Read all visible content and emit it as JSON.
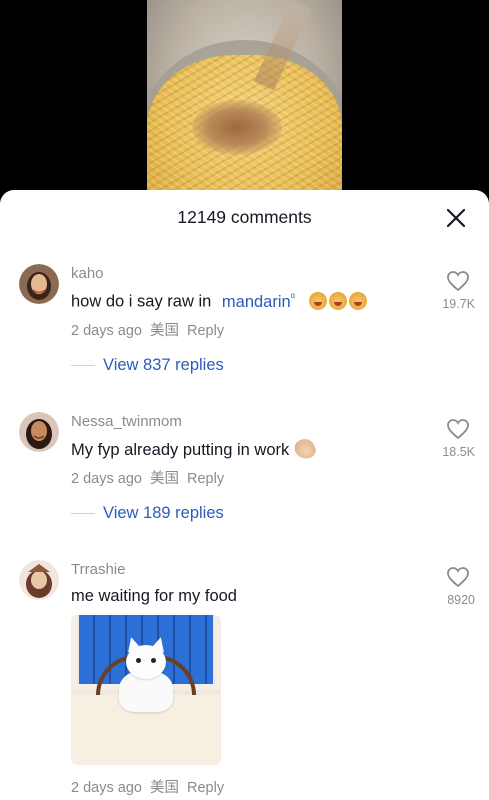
{
  "header": {
    "comment_count": "12149 comments",
    "close_icon": "close-icon"
  },
  "comments": [
    {
      "username": "kaho",
      "text": "how do i say raw in ",
      "link_text": "mandarin",
      "link_suffix": "ᵅ",
      "date": "2 days ago",
      "location": "美国",
      "reply_label": "Reply",
      "likes": "19.7K",
      "view_replies": "View 837 replies",
      "emojis": [
        "emoji-face",
        "emoji-face",
        "emoji-face"
      ]
    },
    {
      "username": "Nessa_twinmom",
      "text": "My fyp already putting in work",
      "date": "2 days ago",
      "location": "美国",
      "reply_label": "Reply",
      "likes": "18.5K",
      "view_replies": "View 189 replies",
      "emojis": [
        "pinching-hand"
      ]
    },
    {
      "username": "Trrashie",
      "text": "me waiting for my food",
      "date": "2 days ago",
      "location": "美国",
      "reply_label": "Reply",
      "likes": "8920",
      "image": "cat-at-table-photo"
    }
  ],
  "colors": {
    "link": "#2b5db8",
    "muted": "#8a8b91",
    "text": "#161823",
    "sheet_bg": "#ffffff"
  }
}
